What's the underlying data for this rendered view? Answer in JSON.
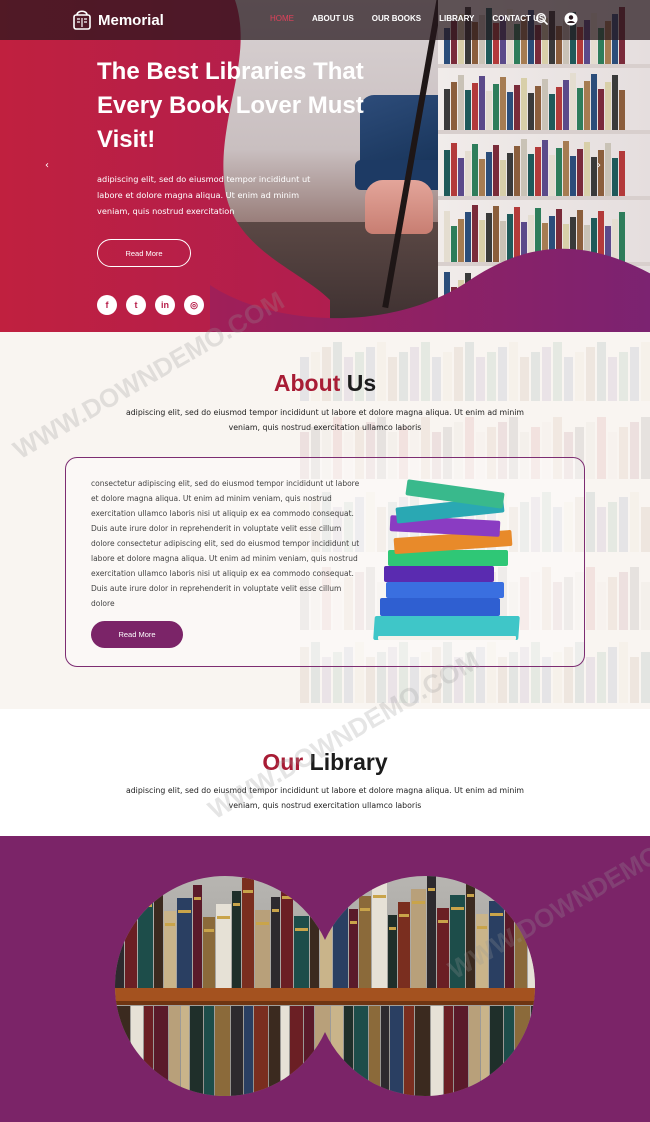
{
  "brand": {
    "name": "Memorial"
  },
  "nav": {
    "items": [
      {
        "label": "HOME",
        "active": true
      },
      {
        "label": "ABOUT US",
        "active": false
      },
      {
        "label": "OUR BOOKS",
        "active": false
      },
      {
        "label": "LIBRARY",
        "active": false
      },
      {
        "label": "CONTACT US",
        "active": false
      }
    ],
    "icons": [
      "search-icon",
      "user-icon"
    ]
  },
  "hero": {
    "title": "The Best Libraries That Every Book Lover Must Visit!",
    "text": "adipiscing elit, sed do eiusmod tempor incididunt ut labore et dolore magna aliqua. Ut enim ad minim veniam, quis nostrud exercitation",
    "button": "Read More",
    "prev_arrow": "‹",
    "next_arrow": "›",
    "socials": [
      {
        "icon": "facebook-icon",
        "glyph": "f"
      },
      {
        "icon": "twitter-icon",
        "glyph": "t"
      },
      {
        "icon": "linkedin-icon",
        "glyph": "in"
      },
      {
        "icon": "instagram-icon",
        "glyph": "◎"
      }
    ]
  },
  "about": {
    "title_accent": "About",
    "title_rest": "Us",
    "subtitle": "adipiscing elit, sed do eiusmod tempor incididunt ut labore et dolore magna aliqua. Ut enim ad minim veniam, quis nostrud exercitation ullamco laboris",
    "card_text": "consectetur adipiscing elit, sed do eiusmod tempor incididunt ut labore et dolore magna aliqua. Ut enim ad minim veniam, quis nostrud exercitation ullamco laboris nisi ut aliquip ex ea commodo consequat. Duis aute irure dolor in reprehenderit in voluptate velit esse cillum dolore consectetur adipiscing elit, sed do eiusmod tempor incididunt ut labore et dolore magna aliqua. Ut enim ad minim veniam, quis nostrud exercitation ullamco laboris nisi ut aliquip ex ea commodo consequat. Duis aute irure dolor in reprehenderit in voluptate velit esse cillum dolore",
    "button": "Read More"
  },
  "library": {
    "title_accent": "Our",
    "title_rest": "Library",
    "subtitle": "adipiscing elit, sed do eiusmod tempor incididunt ut labore et dolore magna aliqua. Ut enim ad minim veniam, quis nostrud exercitation ullamco laboris"
  },
  "watermark": "WWW.DOWNDEMO.COM",
  "colors": {
    "accent_red": "#a81c35",
    "brand_purple": "#7b2468",
    "hero_gradient_start": "#c0203f",
    "hero_gradient_end": "#7d226e"
  }
}
